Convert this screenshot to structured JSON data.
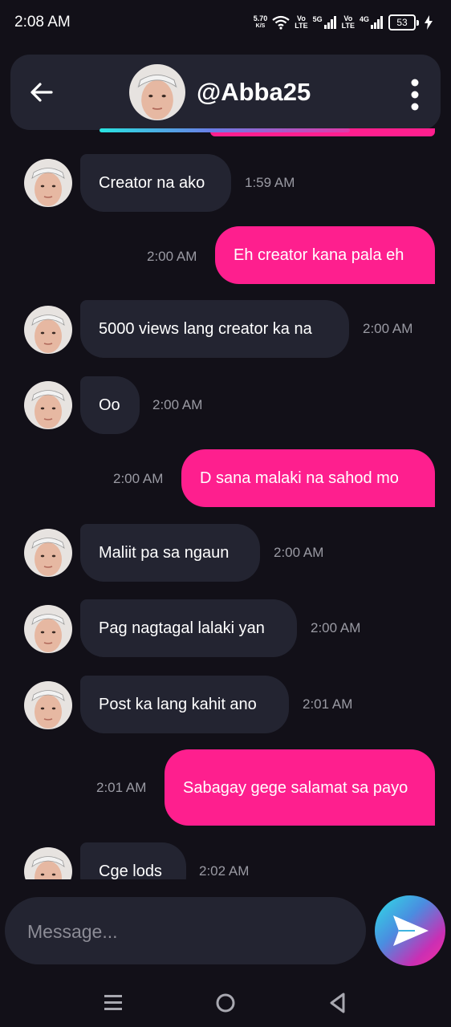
{
  "status_bar": {
    "time": "2:08 AM",
    "speed_value": "5.70",
    "speed_unit": "K/S",
    "vo1_top": "Vo",
    "vo1_bottom": "LTE",
    "net1": "5G",
    "vo2_top": "Vo",
    "vo2_bottom": "LTE",
    "net2": "4G",
    "battery": "53"
  },
  "header": {
    "username": "@Abba25",
    "back_icon": "arrow-left-icon",
    "menu_icon": "more-vertical-icon"
  },
  "colors": {
    "background": "#121018",
    "incoming_bubble": "#232431",
    "outgoing_bubble": "#fe1f8e",
    "timestamp": "#9a9aa3"
  },
  "messages": [
    {
      "dir": "in",
      "text": "Creator na ako",
      "time": "1:59 AM"
    },
    {
      "dir": "out",
      "text": "Eh creator kana pala eh",
      "time": "2:00 AM"
    },
    {
      "dir": "in",
      "text": "5000 views lang creator ka na",
      "time": "2:00 AM"
    },
    {
      "dir": "in",
      "text": "Oo",
      "time": "2:00 AM"
    },
    {
      "dir": "out",
      "text": "D sana malaki na sahod mo",
      "time": "2:00 AM"
    },
    {
      "dir": "in",
      "text": "Maliit pa sa ngaun",
      "time": "2:00 AM"
    },
    {
      "dir": "in",
      "text": "Pag nagtagal lalaki yan",
      "time": "2:00 AM"
    },
    {
      "dir": "in",
      "text": "Post ka lang kahit ano",
      "time": "2:01 AM"
    },
    {
      "dir": "out",
      "text": "Sabagay gege salamat sa payo",
      "time": "2:01 AM"
    },
    {
      "dir": "in",
      "text": "Cge lods",
      "time": "2:02 AM"
    }
  ],
  "composer": {
    "placeholder": "Message...",
    "send_icon": "send-icon"
  },
  "nav": {
    "recent_icon": "menu-icon",
    "home_icon": "home-circle-icon",
    "back_icon": "back-triangle-icon"
  }
}
